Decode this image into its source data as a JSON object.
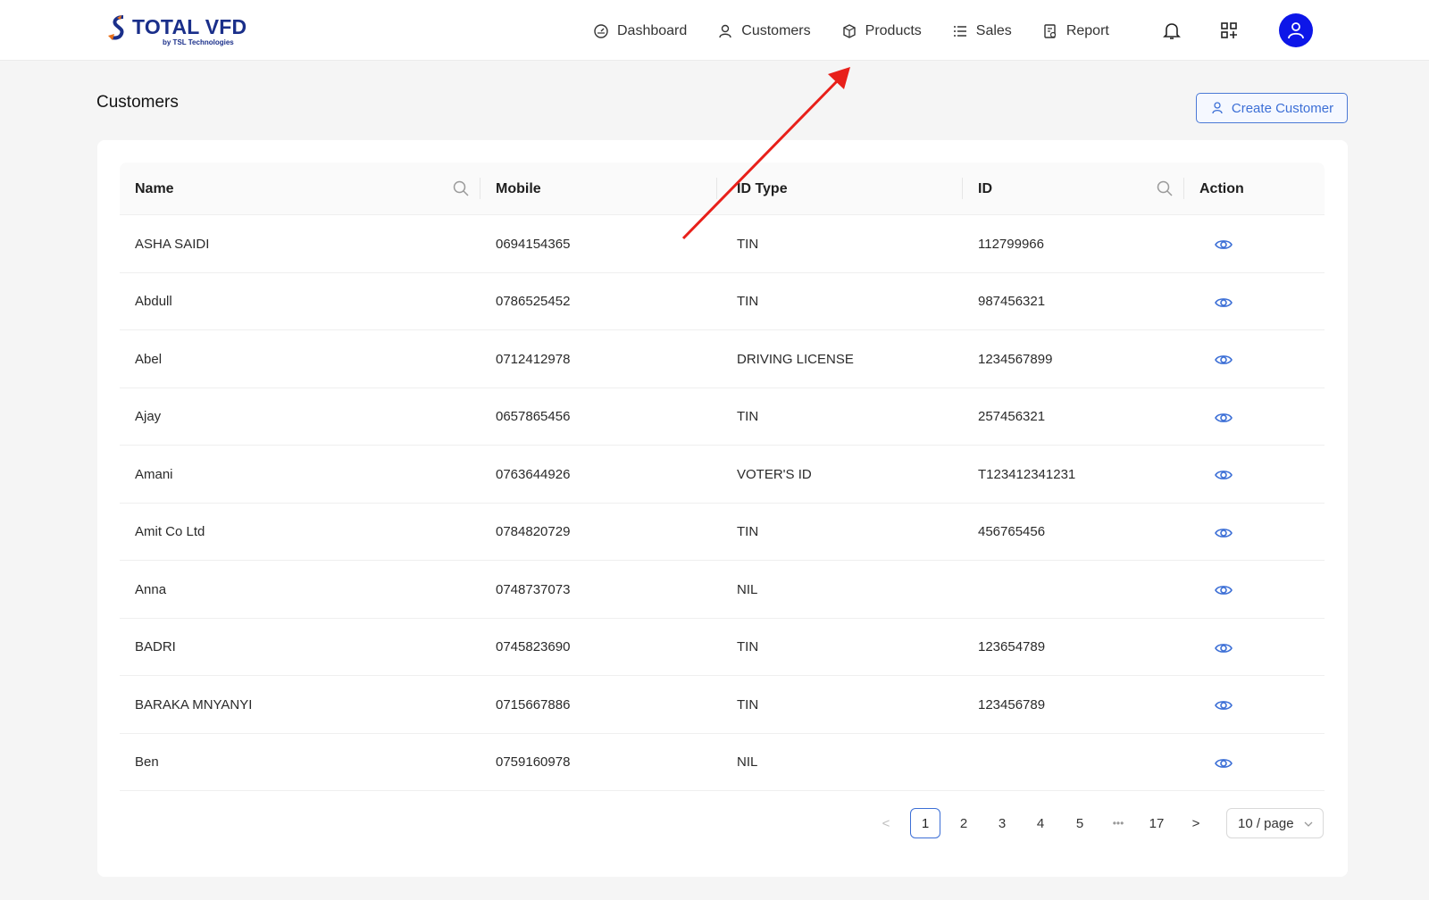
{
  "brand": {
    "title": "TOTAL VFD",
    "subtitle": "by TSL Technologies",
    "icon": "logo-icon"
  },
  "nav": {
    "items": [
      {
        "label": "Dashboard",
        "icon": "dashboard-icon"
      },
      {
        "label": "Customers",
        "icon": "user-icon"
      },
      {
        "label": "Products",
        "icon": "box-icon"
      },
      {
        "label": "Sales",
        "icon": "list-icon"
      },
      {
        "label": "Report",
        "icon": "report-icon"
      }
    ],
    "bell_icon": "bell-icon",
    "apps_icon": "apps-icon",
    "avatar_icon": "user-avatar-icon"
  },
  "page": {
    "title": "Customers",
    "create_label": "Create Customer"
  },
  "table": {
    "columns": [
      "Name",
      "Mobile",
      "ID Type",
      "ID",
      "Action"
    ],
    "rows": [
      {
        "name": "ASHA SAIDI",
        "mobile": "0694154365",
        "id_type": "TIN",
        "id": "112799966"
      },
      {
        "name": "Abdull",
        "mobile": "0786525452",
        "id_type": "TIN",
        "id": "987456321"
      },
      {
        "name": "Abel",
        "mobile": "0712412978",
        "id_type": "DRIVING LICENSE",
        "id": "1234567899"
      },
      {
        "name": "Ajay",
        "mobile": "0657865456",
        "id_type": "TIN",
        "id": "257456321"
      },
      {
        "name": "Amani",
        "mobile": "0763644926",
        "id_type": "VOTER'S ID",
        "id": "T123412341231"
      },
      {
        "name": "Amit Co Ltd",
        "mobile": "0784820729",
        "id_type": "TIN",
        "id": "456765456"
      },
      {
        "name": "Anna",
        "mobile": "0748737073",
        "id_type": "NIL",
        "id": ""
      },
      {
        "name": "BADRI",
        "mobile": "0745823690",
        "id_type": "TIN",
        "id": "123654789"
      },
      {
        "name": "BARAKA MNYANYI",
        "mobile": "0715667886",
        "id_type": "TIN",
        "id": "123456789"
      },
      {
        "name": "Ben",
        "mobile": "0759160978",
        "id_type": "NIL",
        "id": ""
      }
    ]
  },
  "pagination": {
    "prev": "<",
    "pages": [
      "1",
      "2",
      "3",
      "4",
      "5"
    ],
    "ellipsis": "•••",
    "last": "17",
    "next": ">",
    "current": "1",
    "page_size": "10 / page"
  },
  "colors": {
    "accent": "#3c6fd6",
    "avatar": "#0d16e8",
    "annotation_arrow": "#e8201a"
  }
}
